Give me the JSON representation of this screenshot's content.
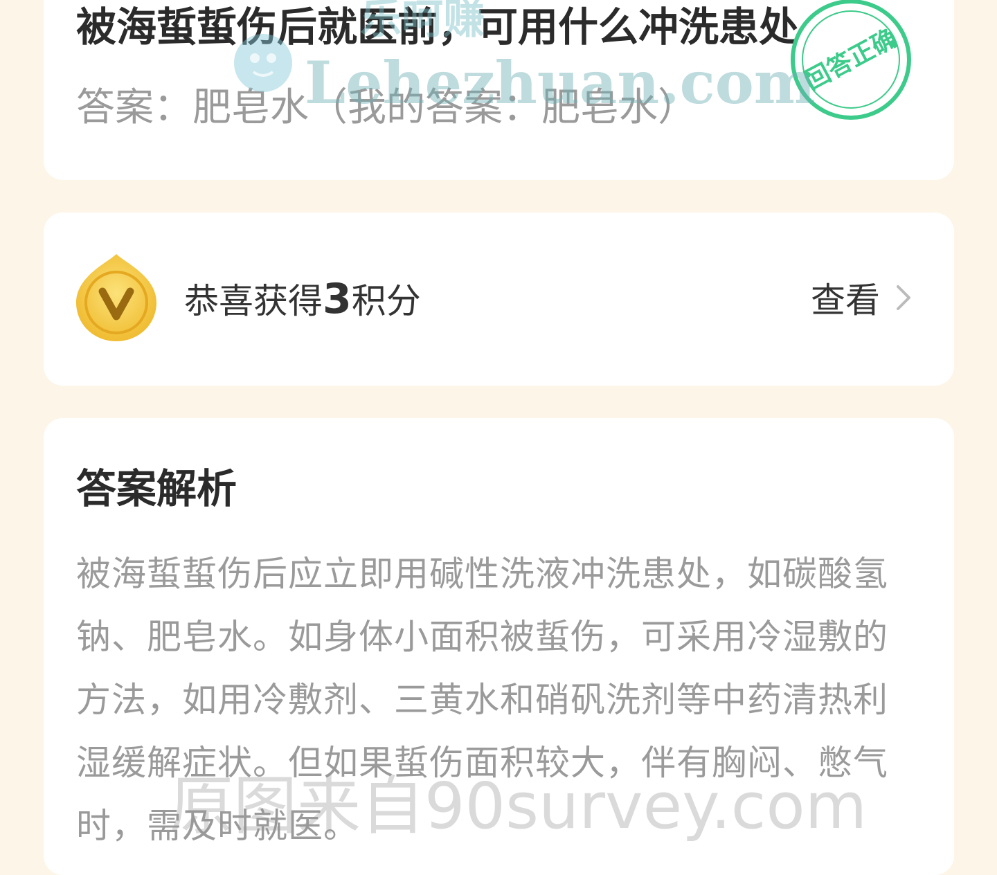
{
  "question": {
    "title": "被海蜇蜇伤后就医前，可用什么冲洗患处",
    "answer_line": "答案：肥皂水（我的答案：肥皂水）",
    "stamp_text": "回答正确"
  },
  "points": {
    "text_prefix": "恭喜获得",
    "amount": "3",
    "text_suffix": "积分",
    "view_label": "查看"
  },
  "analysis": {
    "title": "答案解析",
    "body": "被海蜇蜇伤后应立即用碱性洗液冲洗患处，如碳酸氢钠、肥皂水。如身体小面积被蜇伤，可采用冷湿敷的方法，如用冷敷剂、三黄水和硝矾洗剂等中药清热利湿缓解症状。但如果蜇伤面积较大，伴有胸闷、憋气时，需及时就医。"
  },
  "watermarks": {
    "top_cn": "乐呵赚",
    "top_domain": "Lehezhuan.com",
    "bottom": "原图来自90survey.com"
  },
  "colors": {
    "page_background": "#FDF6E8",
    "card_background": "#FFFFFF",
    "stamp_green": "#3CCB8A",
    "coin_gold": "#F5C842"
  }
}
